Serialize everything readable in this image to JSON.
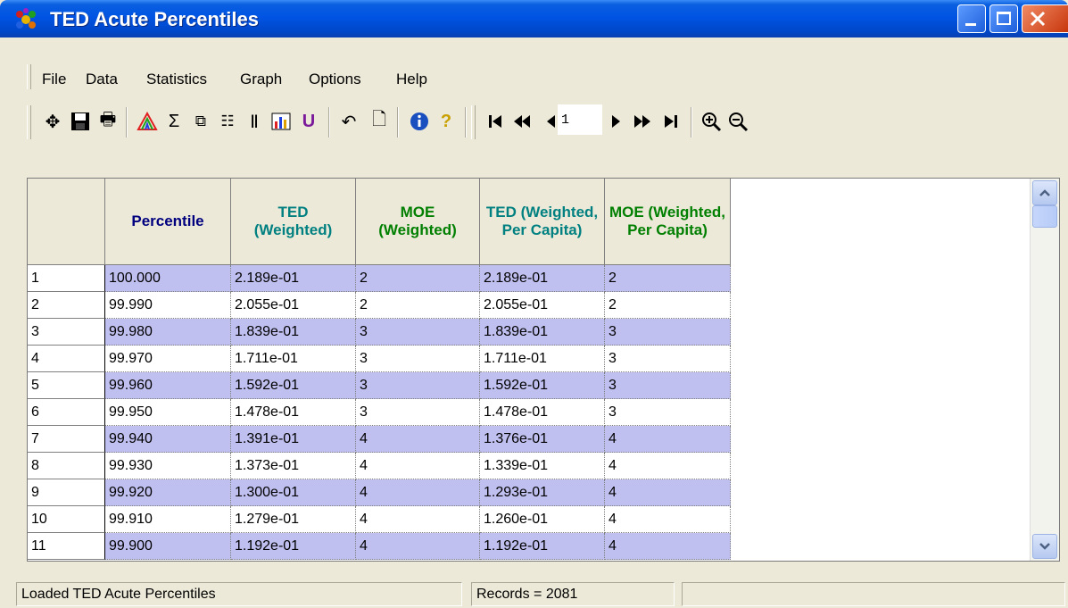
{
  "window": {
    "title": "TED Acute Percentiles"
  },
  "menu": [
    "File",
    "Data",
    "Statistics",
    "Graph",
    "Options",
    "Help"
  ],
  "toolbar": {
    "icons": [
      "move-icon",
      "save-icon",
      "print-icon",
      "colors-icon",
      "sum-icon",
      "columns-icon",
      "rows-icon",
      "filter-icon",
      "chart-icon",
      "union-icon",
      "undo-icon",
      "edit-icon",
      "info-icon",
      "help-icon",
      "first-page-icon",
      "prev-fast-icon",
      "prev-page-icon",
      "next-page-icon",
      "next-fast-icon",
      "last-page-icon",
      "zoom-in-icon",
      "zoom-out-icon"
    ],
    "page_value": "1"
  },
  "table": {
    "headers": [
      "Percentile",
      "TED (Weighted)",
      "MOE (Weighted)",
      "TED (Weighted, Per Capita)",
      "MOE (Weighted, Per Capita)"
    ],
    "colors": {
      "header_primary": "#00007F",
      "header_ted": "#008080",
      "header_moe": "#007F00",
      "row_alt": "#C0C0F0",
      "row_plain": "#FFFFFF"
    },
    "rows": [
      [
        "1",
        "100.000",
        "2.189e-01",
        "2",
        "2.189e-01",
        "2"
      ],
      [
        "2",
        "99.990",
        "2.055e-01",
        "2",
        "2.055e-01",
        "2"
      ],
      [
        "3",
        "99.980",
        "1.839e-01",
        "3",
        "1.839e-01",
        "3"
      ],
      [
        "4",
        "99.970",
        "1.711e-01",
        "3",
        "1.711e-01",
        "3"
      ],
      [
        "5",
        "99.960",
        "1.592e-01",
        "3",
        "1.592e-01",
        "3"
      ],
      [
        "6",
        "99.950",
        "1.478e-01",
        "3",
        "1.478e-01",
        "3"
      ],
      [
        "7",
        "99.940",
        "1.391e-01",
        "4",
        "1.376e-01",
        "4"
      ],
      [
        "8",
        "99.930",
        "1.373e-01",
        "4",
        "1.339e-01",
        "4"
      ],
      [
        "9",
        "99.920",
        "1.300e-01",
        "4",
        "1.293e-01",
        "4"
      ],
      [
        "10",
        "99.910",
        "1.279e-01",
        "4",
        "1.260e-01",
        "4"
      ],
      [
        "11",
        "99.900",
        "1.192e-01",
        "4",
        "1.192e-01",
        "4"
      ]
    ]
  },
  "status": {
    "message": "Loaded TED Acute Percentiles",
    "records": "Records = 2081"
  }
}
